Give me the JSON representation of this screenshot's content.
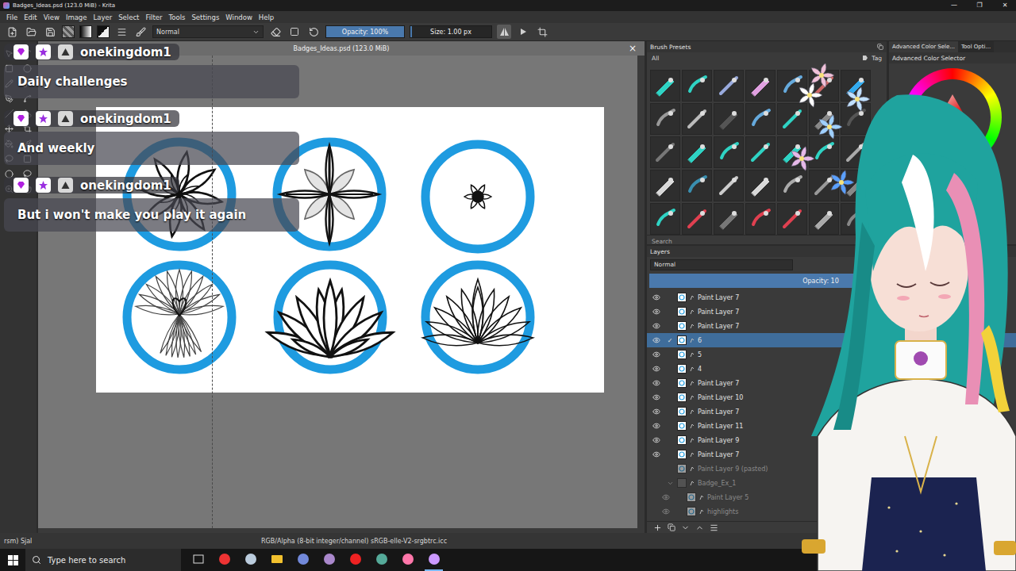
{
  "window": {
    "title": "Badges_Ideas.psd (123.0 MiB) - Krita",
    "controls": [
      "—",
      "❐",
      "✕"
    ]
  },
  "menu": [
    "File",
    "Edit",
    "View",
    "Image",
    "Layer",
    "Select",
    "Filter",
    "Tools",
    "Settings",
    "Window",
    "Help"
  ],
  "toolbar": {
    "blend_mode": "Normal",
    "opacity": {
      "reading": "Opacity: 100%",
      "level": 1
    },
    "size": {
      "reading": "Size: 1.00 px",
      "level": 0.02
    },
    "mirror": {
      "on": true
    }
  },
  "document": {
    "tab": "Badges_Ideas.psd (123.0 MiB)",
    "close": "×"
  },
  "chat": [
    {
      "user": "onekingdom1",
      "message": "Daily challenges"
    },
    {
      "user": "onekingdom1",
      "message": "And weekly"
    },
    {
      "user": "onekingdom1",
      "message": "But i won't make you play it again"
    }
  ],
  "brush_presets": {
    "title": "Brush Presets",
    "filter": "All",
    "tag": "Tag",
    "search": "Search"
  },
  "color_selector": {
    "tabs": [
      {
        "label": "Advanced Color Sele...",
        "selected": true
      },
      {
        "label": "Tool Opti...",
        "selected": false
      }
    ],
    "title": "Advanced Color Selector"
  },
  "layers": {
    "title": "Layers",
    "blend_mode": "Normal",
    "opacity": {
      "reading": "Opacity: 10",
      "level": 1
    },
    "selected_mark": "✓",
    "items": [
      {
        "name": "Paint Layer 7",
        "kind": "paint",
        "visible": true,
        "selected": false,
        "dimmed": false,
        "child": false
      },
      {
        "name": "Paint Layer 7",
        "kind": "paint",
        "visible": true,
        "selected": false,
        "dimmed": false,
        "child": false
      },
      {
        "name": "Paint Layer 7",
        "kind": "paint",
        "visible": true,
        "selected": false,
        "dimmed": false,
        "child": false
      },
      {
        "name": "6",
        "kind": "paint",
        "visible": true,
        "selected": true,
        "dimmed": false,
        "child": false
      },
      {
        "name": "5",
        "kind": "paint",
        "visible": true,
        "selected": false,
        "dimmed": false,
        "child": false
      },
      {
        "name": "4",
        "kind": "paint",
        "visible": true,
        "selected": false,
        "dimmed": false,
        "child": false
      },
      {
        "name": "Paint Layer 7",
        "kind": "paint",
        "visible": true,
        "selected": false,
        "dimmed": false,
        "child": false
      },
      {
        "name": "Paint Layer 10",
        "kind": "paint",
        "visible": true,
        "selected": false,
        "dimmed": false,
        "child": false
      },
      {
        "name": "Paint Layer 7",
        "kind": "paint",
        "visible": true,
        "selected": false,
        "dimmed": false,
        "child": false
      },
      {
        "name": "Paint Layer 11",
        "kind": "paint",
        "visible": true,
        "selected": false,
        "dimmed": false,
        "child": false
      },
      {
        "name": "Paint Layer 9",
        "kind": "paint",
        "visible": true,
        "selected": false,
        "dimmed": false,
        "child": false
      },
      {
        "name": "Paint Layer 7",
        "kind": "paint",
        "visible": true,
        "selected": false,
        "dimmed": false,
        "child": false
      },
      {
        "name": "Paint Layer 9 (pasted)",
        "kind": "paint",
        "visible": false,
        "selected": false,
        "dimmed": true,
        "child": false
      },
      {
        "name": "Badge_Ex_1",
        "kind": "group",
        "visible": false,
        "selected": false,
        "dimmed": true,
        "child": false
      },
      {
        "name": "Paint Layer 5",
        "kind": "paint",
        "visible": true,
        "selected": false,
        "dimmed": true,
        "child": true
      },
      {
        "name": "highlights",
        "kind": "paint",
        "visible": true,
        "selected": false,
        "dimmed": true,
        "child": true
      }
    ]
  },
  "status_bar": {
    "left": "rsm) Sjal",
    "center": "RGB/Alpha (8-bit integer/channel) sRGB-elle-V2-srgbtrc.icc"
  },
  "taskbar": {
    "search_placeholder": "Type here to search"
  }
}
